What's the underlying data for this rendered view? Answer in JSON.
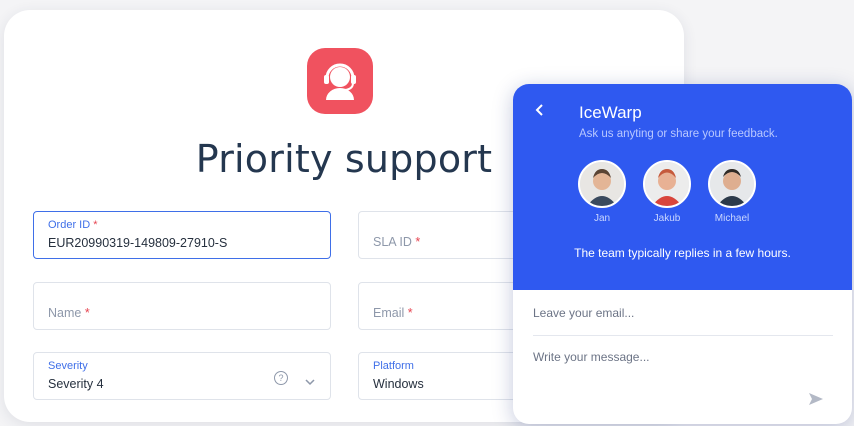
{
  "form": {
    "title": "Priority support",
    "order_id": {
      "label": "Order ID",
      "required": "*",
      "value": "EUR20990319-149809-27910-S"
    },
    "sla_id": {
      "label": "SLA ID",
      "required": "*"
    },
    "name": {
      "label": "Name",
      "required": "*"
    },
    "email": {
      "label": "Email",
      "required": "*"
    },
    "severity": {
      "label": "Severity",
      "value": "Severity 4"
    },
    "platform": {
      "label": "Platform",
      "value": "Windows"
    }
  },
  "chat": {
    "title": "IceWarp",
    "subtitle": "Ask us anyting or share your feedback.",
    "team": [
      {
        "name": "Jan"
      },
      {
        "name": "Jakub"
      },
      {
        "name": "Michael"
      }
    ],
    "reply_note": "The team typically replies in a few hours.",
    "email_placeholder": "Leave your email...",
    "message_placeholder": "Write your message..."
  },
  "colors": {
    "accent_red": "#f0525f",
    "chat_blue": "#2f59f0",
    "focus_blue": "#3f6fe8",
    "title_text": "#24374f"
  },
  "icons": [
    "headset-support-icon",
    "help-circle-icon",
    "chevron-down-icon",
    "chevron-left-icon",
    "send-icon"
  ]
}
